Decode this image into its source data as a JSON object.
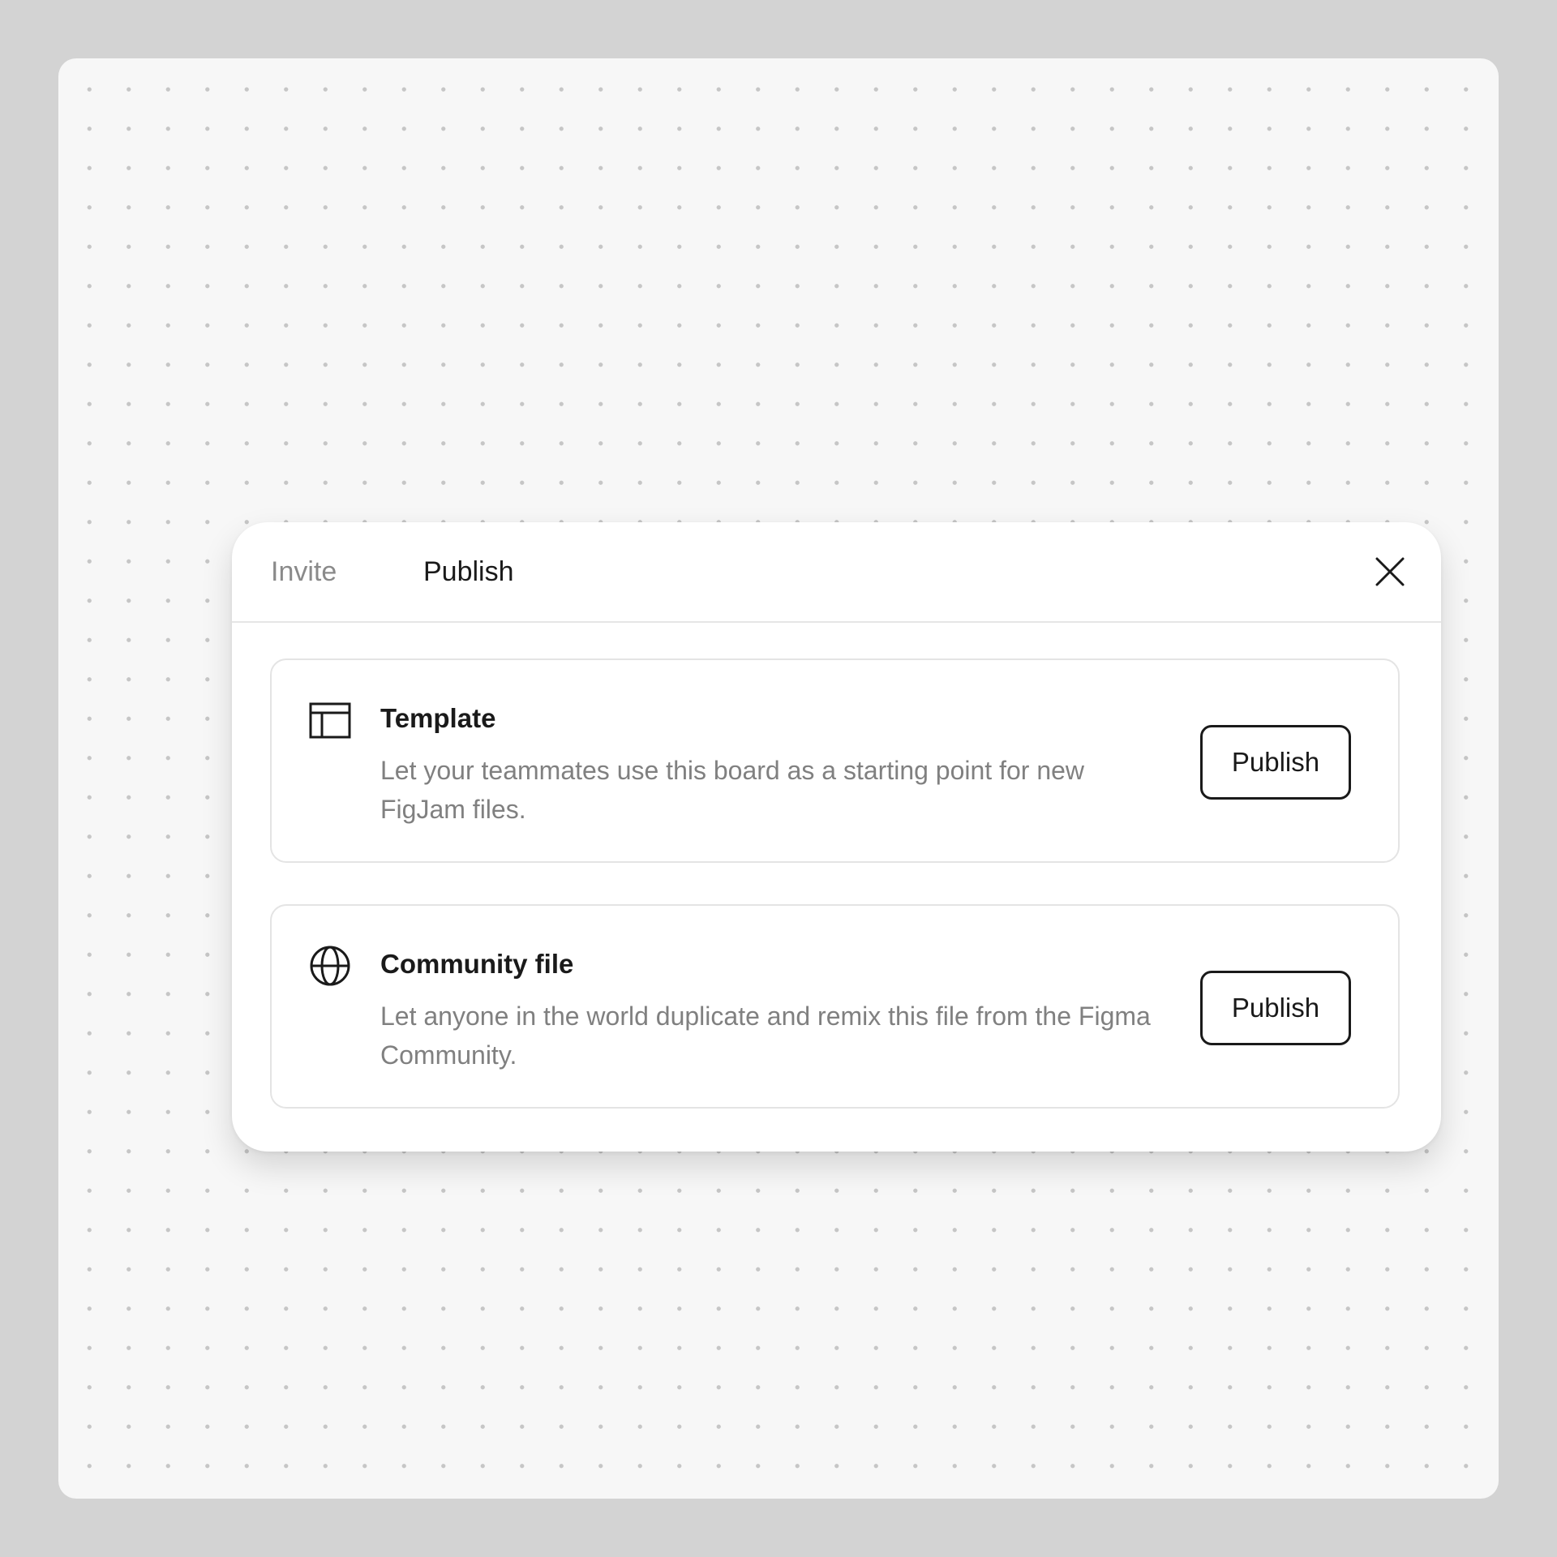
{
  "dialog": {
    "tabs": [
      {
        "label": "Invite",
        "active": false
      },
      {
        "label": "Publish",
        "active": true
      }
    ],
    "close_icon": "close-icon"
  },
  "options": [
    {
      "icon": "template-layout-icon",
      "title": "Template",
      "description": "Let your teammates use this board as a starting point for new FigJam files.",
      "button_label": "Publish"
    },
    {
      "icon": "globe-icon",
      "title": "Community file",
      "description": "Let anyone in the world duplicate and remix this file from the Figma Community.",
      "button_label": "Publish"
    }
  ],
  "colors": {
    "background": "#d3d3d3",
    "canvas": "#f7f7f7",
    "dot": "#c6c6c6",
    "text_primary": "#1a1a1a",
    "text_secondary": "#808080",
    "border": "#e4e4e4"
  }
}
